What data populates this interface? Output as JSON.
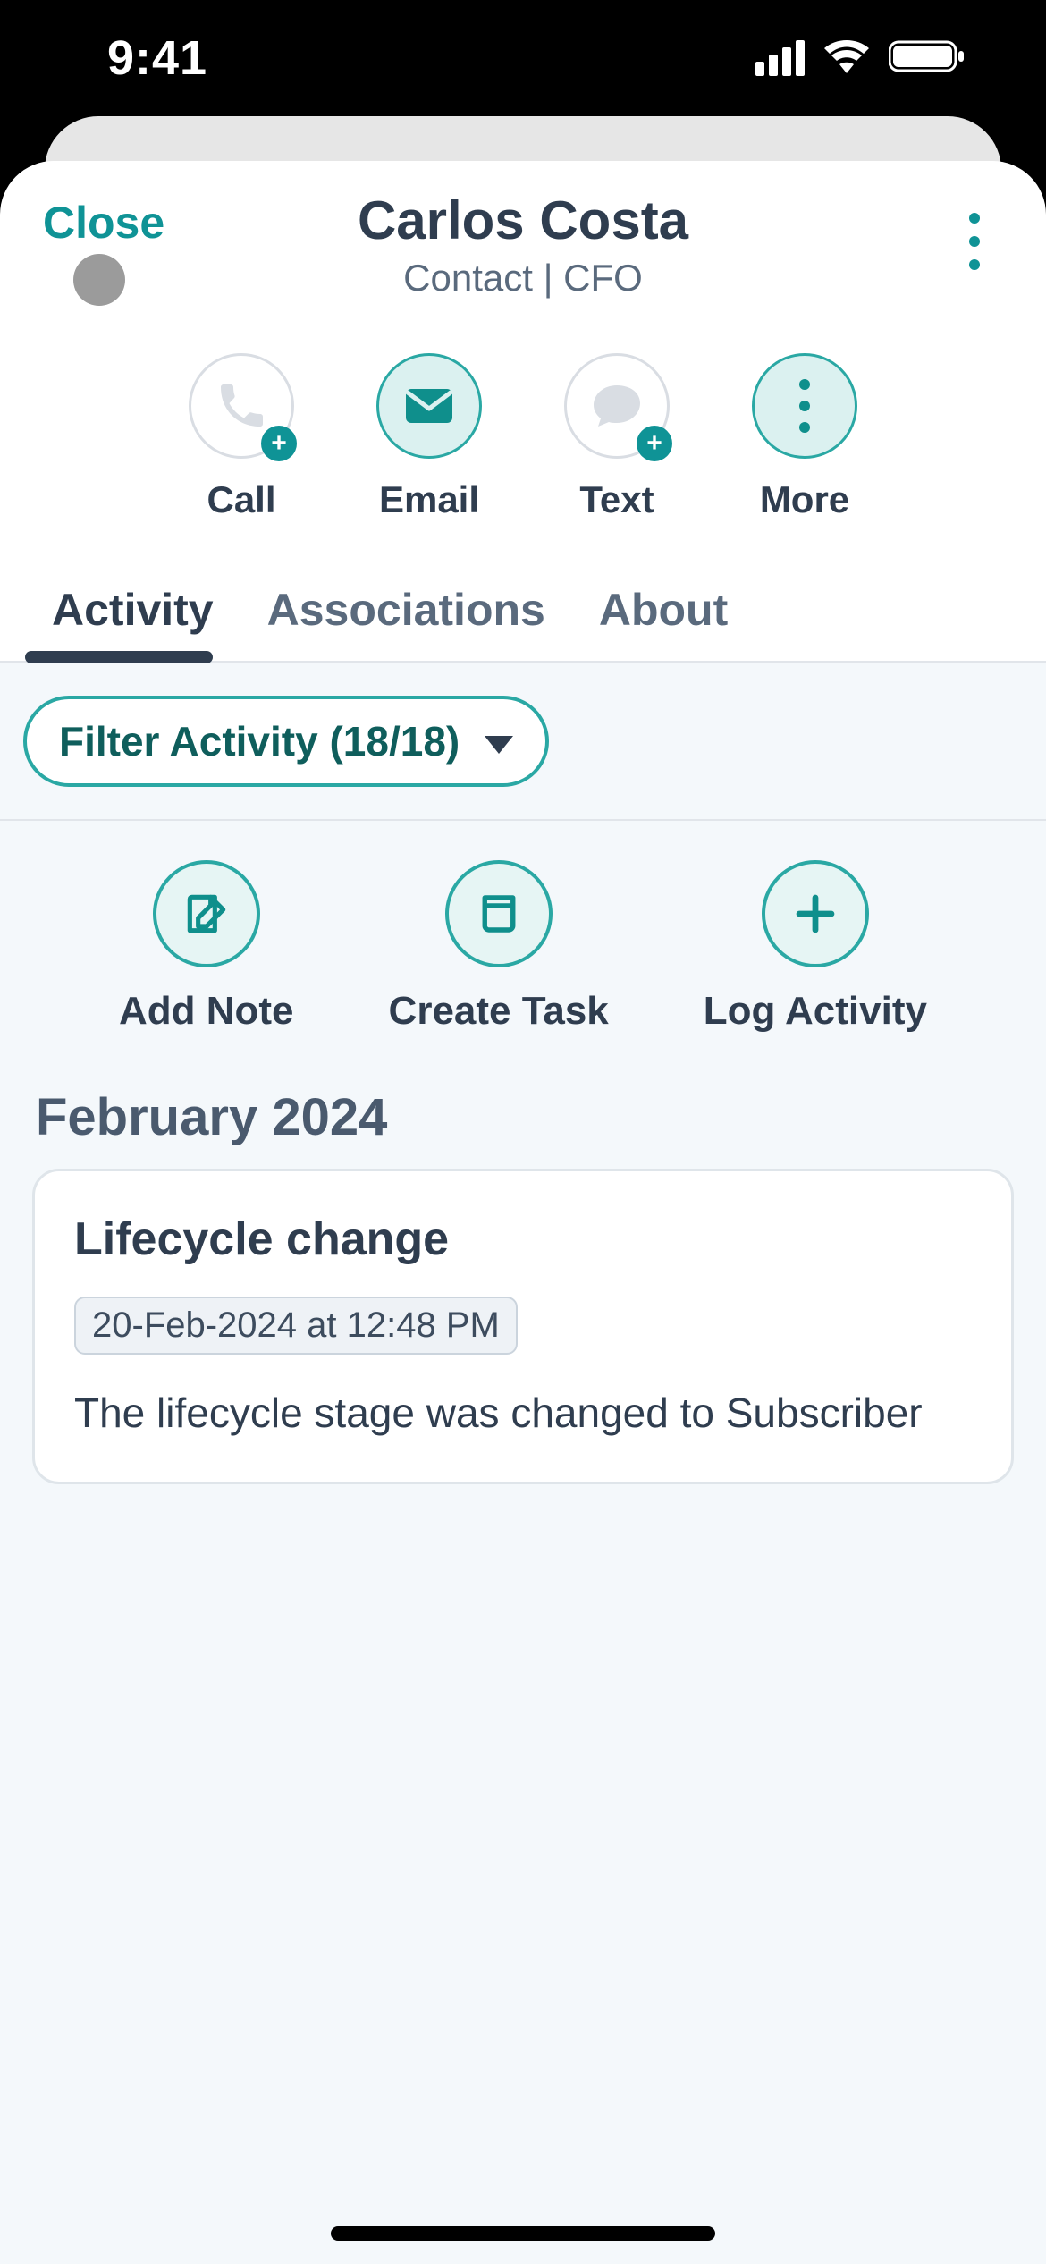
{
  "status": {
    "time": "9:41"
  },
  "header": {
    "close_label": "Close",
    "name": "Carlos Costa",
    "subtitle": "Contact | CFO"
  },
  "actions": {
    "call": "Call",
    "email": "Email",
    "text": "Text",
    "more": "More"
  },
  "tabs": {
    "activity": "Activity",
    "associations": "Associations",
    "about": "About"
  },
  "filter": {
    "label": "Filter Activity (18/18)"
  },
  "quick": {
    "note": "Add Note",
    "task": "Create Task",
    "log": "Log Activity"
  },
  "timeline": {
    "section": "February 2024",
    "card": {
      "title": "Lifecycle change",
      "date": "20-Feb-2024 at 12:48 PM",
      "body": "The lifecycle stage was changed to Subscriber"
    }
  }
}
